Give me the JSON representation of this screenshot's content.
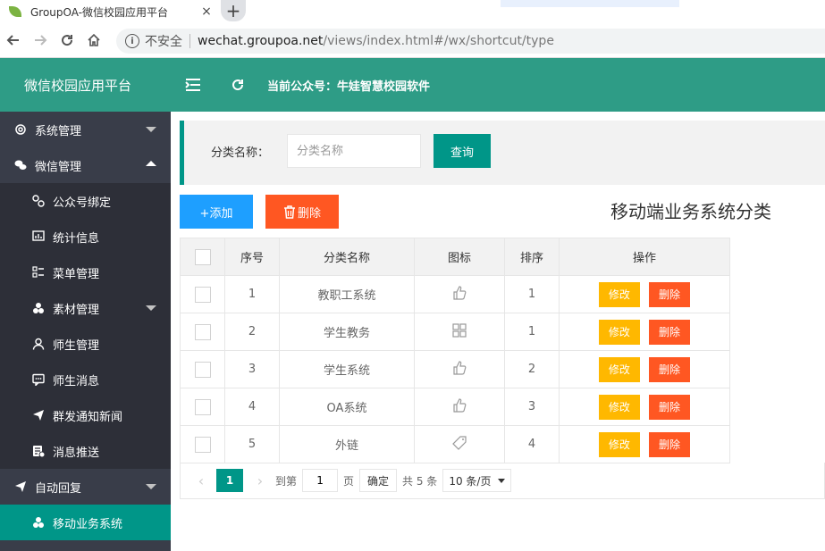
{
  "browser": {
    "tab_title": "GroupOA-微信校园应用平台",
    "tab_close": "×",
    "new_tab": "+",
    "insecure_label": "不安全",
    "url_host": "wechat.groupoa.net",
    "url_path": "/views/index.html#/wx/shortcut/type"
  },
  "header": {
    "logo": "微信校园应用平台",
    "account": "当前公众号：牛娃智慧校园软件"
  },
  "sidebar": {
    "items": [
      {
        "label": "系统管理",
        "icon": "gear-icon"
      },
      {
        "label": "微信管理",
        "icon": "wechat-icon"
      },
      {
        "label": "公众号绑定",
        "icon": "link-icon"
      },
      {
        "label": "统计信息",
        "icon": "chart-icon"
      },
      {
        "label": "菜单管理",
        "icon": "menu-icon"
      },
      {
        "label": "素材管理",
        "icon": "material-icon"
      },
      {
        "label": "师生管理",
        "icon": "user-icon"
      },
      {
        "label": "师生消息",
        "icon": "message-icon"
      },
      {
        "label": "群发通知新闻",
        "icon": "send-icon"
      },
      {
        "label": "消息推送",
        "icon": "push-icon"
      },
      {
        "label": "自动回复",
        "icon": "send-icon"
      },
      {
        "label": "移动业务系统",
        "icon": "material-icon"
      }
    ]
  },
  "search": {
    "label": "分类名称：",
    "placeholder": "分类名称",
    "button": "查询"
  },
  "toolbar": {
    "add_label": "+添加",
    "delete_label": "删除",
    "page_title": "移动端业务系统分类"
  },
  "table": {
    "headers": [
      "序号",
      "分类名称",
      "图标",
      "排序",
      "操作"
    ],
    "rows": [
      {
        "no": "1",
        "name": "教职工系统",
        "icon": "thumbs-up-icon",
        "order": "1",
        "edit": "修改",
        "del": "删除"
      },
      {
        "no": "2",
        "name": "学生教务",
        "icon": "grid-icon",
        "order": "1",
        "edit": "修改",
        "del": "删除"
      },
      {
        "no": "3",
        "name": "学生系统",
        "icon": "thumbs-up-icon",
        "order": "2",
        "edit": "修改",
        "del": "删除"
      },
      {
        "no": "4",
        "name": "OA系统",
        "icon": "thumbs-up-icon",
        "order": "3",
        "edit": "修改",
        "del": "删除"
      },
      {
        "no": "5",
        "name": "外链",
        "icon": "tag-icon",
        "order": "4",
        "edit": "修改",
        "del": "删除"
      }
    ]
  },
  "pager": {
    "current": "1",
    "goto_label": "到第",
    "goto_value": "1",
    "page_unit": "页",
    "confirm": "确定",
    "total": "共 5 条",
    "page_size": "10 条/页"
  },
  "colors": {
    "header": "#2e9c86",
    "sidebar": "#393d49",
    "active": "#009688",
    "add": "#1e9fff",
    "delete": "#ff5722",
    "edit": "#ffb800"
  }
}
